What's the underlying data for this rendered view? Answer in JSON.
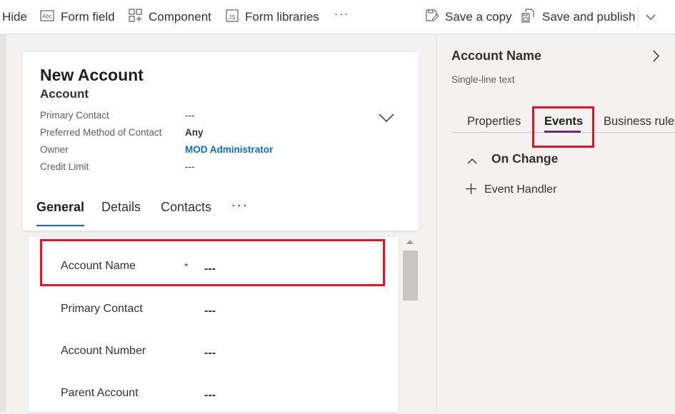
{
  "toolbar": {
    "hide_label": "Hide",
    "form_field_label": "Form field",
    "component_label": "Component",
    "form_libraries_label": "Form libraries",
    "more_label": "···",
    "save_copy_label": "Save a copy",
    "save_publish_label": "Save and publish"
  },
  "form_header": {
    "title": "New Account",
    "entity": "Account",
    "fields": [
      {
        "label": "Primary Contact",
        "value": "---"
      },
      {
        "label": "Preferred Method of Contact",
        "value": "Any"
      },
      {
        "label": "Owner",
        "value": "MOD Administrator"
      },
      {
        "label": "Credit Limit",
        "value": "---"
      }
    ]
  },
  "form_tabs": {
    "items": [
      "General",
      "Details",
      "Contacts"
    ],
    "active": "General",
    "more": "···"
  },
  "section": {
    "fields": [
      {
        "label": "Account Name",
        "required_marker": "*",
        "value": "---"
      },
      {
        "label": "Primary Contact",
        "value": "---"
      },
      {
        "label": "Account Number",
        "value": "---"
      },
      {
        "label": "Parent Account",
        "value": "---"
      }
    ]
  },
  "properties_panel": {
    "title": "Account Name",
    "subtitle": "Single-line text",
    "tabs": [
      "Properties",
      "Events",
      "Business rules"
    ],
    "active_tab": "Events",
    "event_section": "On Change",
    "add_handler_label": "Event Handler"
  },
  "colors": {
    "accent_blue": "#0f6cbd",
    "accent_purple": "#742774",
    "highlight_red": "#e81123",
    "required_red": "#a4262c"
  },
  "icons": {
    "form_field": "form-field-icon",
    "component": "component-icon",
    "form_libraries": "js-library-icon",
    "save_copy": "save-copy-icon",
    "save_publish": "save-publish-icon",
    "dropdown": "chevron-down-icon",
    "expand_header": "chevron-down-icon",
    "panel_next": "chevron-right-icon",
    "collapse_section": "chevron-up-icon",
    "add": "plus-icon"
  }
}
